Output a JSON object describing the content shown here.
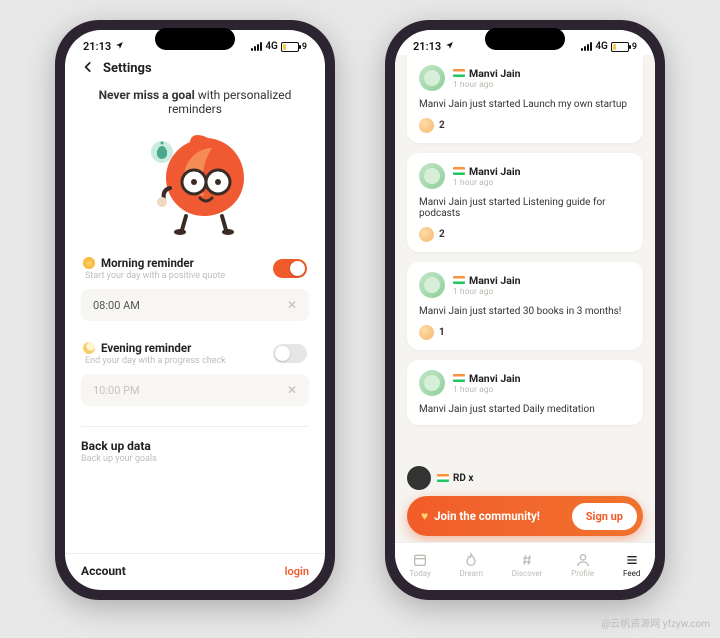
{
  "status": {
    "time": "21:13",
    "net": "4G",
    "batt": "9"
  },
  "settings": {
    "title": "Settings",
    "hero_bold": "Never miss a goal",
    "hero_rest": " with personalized reminders",
    "morning": {
      "label": "Morning reminder",
      "sub": "Start your day with a positive quote",
      "time": "08:00 AM"
    },
    "evening": {
      "label": "Evening reminder",
      "sub": "End your day with a progress check",
      "time": "10:00 PM"
    },
    "backup": {
      "title": "Back up data",
      "sub": "Back up your goals"
    },
    "account": "Account",
    "login": "login"
  },
  "feed": {
    "items": [
      {
        "name": "Manvi Jain",
        "time": "1 hour ago",
        "body": "Manvi Jain just started Launch my own startup",
        "count": "2"
      },
      {
        "name": "Manvi Jain",
        "time": "1 hour ago",
        "body": "Manvi Jain just started Listening guide for podcasts",
        "count": "2"
      },
      {
        "name": "Manvi Jain",
        "time": "1 hour ago",
        "body": "Manvi Jain just started 30 books in 3 months!",
        "count": "1"
      },
      {
        "name": "Manvi Jain",
        "time": "1 hour ago",
        "body": "Manvi Jain just started Daily meditation",
        "count": ""
      }
    ],
    "peek_name": "RD x",
    "cta": "Join the community!",
    "cta_btn": "Sign up",
    "tabs": {
      "t0": "Today",
      "t1": "Dream",
      "t2": "Discover",
      "t3": "Profile",
      "t4": "Feed"
    }
  },
  "watermark": "@云帆资源网 yfzyw.com"
}
